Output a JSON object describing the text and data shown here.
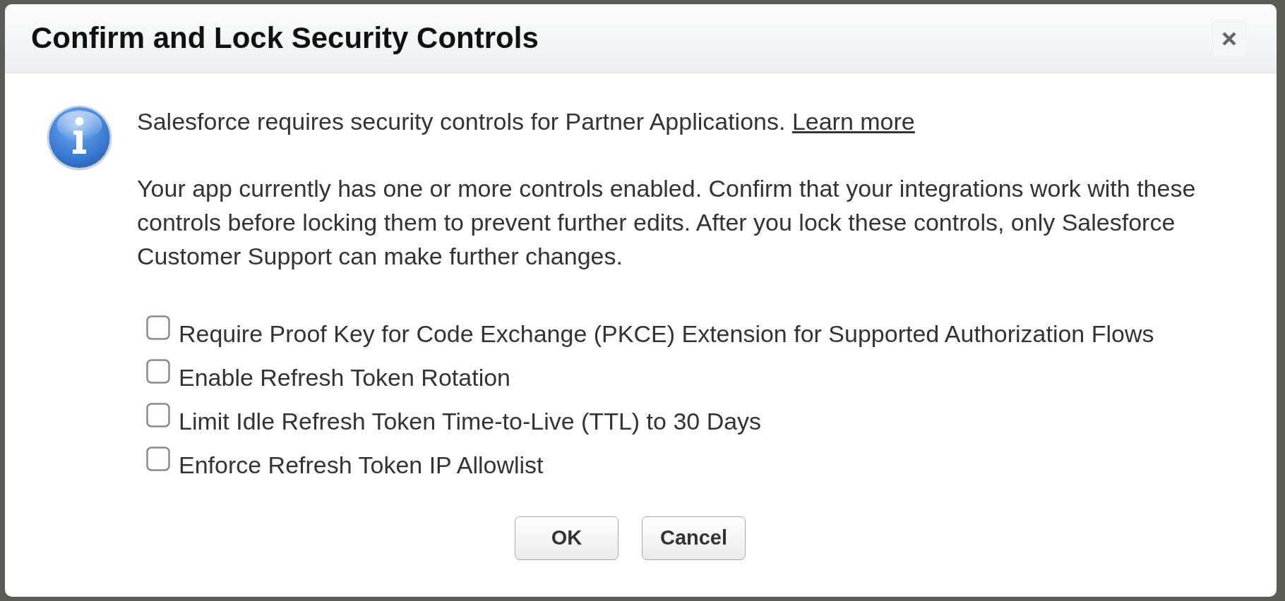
{
  "dialog": {
    "title": "Confirm and Lock Security Controls"
  },
  "notice": {
    "text": "Salesforce requires security controls for Partner Applications.",
    "link": "Learn more"
  },
  "description": "Your app currently has one or more controls enabled. Confirm that your integrations work with these controls before locking them to prevent further edits. After you lock these controls, only Salesforce Customer Support can make further changes.",
  "options": [
    {
      "label": "Require Proof Key for Code Exchange (PKCE) Extension for Supported Authorization Flows",
      "checked": false
    },
    {
      "label": "Enable Refresh Token Rotation",
      "checked": false
    },
    {
      "label": "Limit Idle Refresh Token Time-to-Live (TTL) to 30 Days",
      "checked": false
    },
    {
      "label": "Enforce Refresh Token IP Allowlist",
      "checked": false
    }
  ],
  "buttons": [
    {
      "label": "OK"
    },
    {
      "label": "Cancel"
    }
  ]
}
